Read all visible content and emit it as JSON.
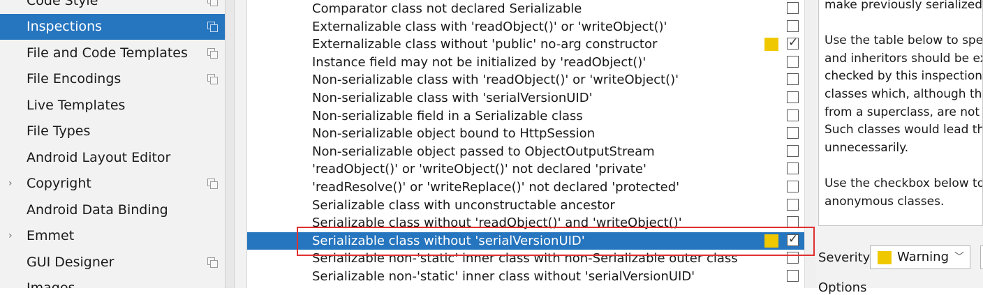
{
  "sidebar": {
    "items": [
      {
        "label": "Code Style",
        "arrow": "",
        "copy_icon": true
      },
      {
        "label": "Inspections",
        "arrow": "",
        "copy_icon": true,
        "selected": true
      },
      {
        "label": "File and Code Templates",
        "arrow": "",
        "copy_icon": true
      },
      {
        "label": "File Encodings",
        "arrow": "",
        "copy_icon": true
      },
      {
        "label": "Live Templates",
        "arrow": "",
        "copy_icon": false
      },
      {
        "label": "File Types",
        "arrow": "",
        "copy_icon": false
      },
      {
        "label": "Android Layout Editor",
        "arrow": "",
        "copy_icon": false
      },
      {
        "label": "Copyright",
        "arrow": "›",
        "copy_icon": true
      },
      {
        "label": "Android Data Binding",
        "arrow": "",
        "copy_icon": false
      },
      {
        "label": "Emmet",
        "arrow": "›",
        "copy_icon": false
      },
      {
        "label": "GUI Designer",
        "arrow": "",
        "copy_icon": true
      },
      {
        "label": "Images",
        "arrow": "",
        "copy_icon": false
      }
    ]
  },
  "inspections": {
    "rows": [
      {
        "label": "Comparator class not declared Serializable",
        "checked": false,
        "severity_color": ""
      },
      {
        "label": "Externalizable class with 'readObject()' or 'writeObject()'",
        "checked": false,
        "severity_color": ""
      },
      {
        "label": "Externalizable class without 'public' no-arg constructor",
        "checked": true,
        "severity_color": "#f0c800"
      },
      {
        "label": "Instance field may not be initialized by 'readObject()'",
        "checked": false,
        "severity_color": ""
      },
      {
        "label": "Non-serializable class with 'readObject()' or 'writeObject()'",
        "checked": false,
        "severity_color": ""
      },
      {
        "label": "Non-serializable class with 'serialVersionUID'",
        "checked": false,
        "severity_color": ""
      },
      {
        "label": "Non-serializable field in a Serializable class",
        "checked": false,
        "severity_color": ""
      },
      {
        "label": "Non-serializable object bound to HttpSession",
        "checked": false,
        "severity_color": ""
      },
      {
        "label": "Non-serializable object passed to ObjectOutputStream",
        "checked": false,
        "severity_color": ""
      },
      {
        "label": "'readObject()' or 'writeObject()' not declared 'private'",
        "checked": false,
        "severity_color": ""
      },
      {
        "label": "'readResolve()' or 'writeReplace()' not declared 'protected'",
        "checked": false,
        "severity_color": ""
      },
      {
        "label": "Serializable class with unconstructable ancestor",
        "checked": false,
        "severity_color": ""
      },
      {
        "label": "Serializable class without 'readObject()' and 'writeObject()'",
        "checked": false,
        "severity_color": ""
      },
      {
        "label": "Serializable class without 'serialVersionUID'",
        "checked": true,
        "severity_color": "#f0c800",
        "selected": true
      },
      {
        "label": "Serializable non-'static' inner class with non-Serializable outer class",
        "checked": false,
        "severity_color": ""
      },
      {
        "label": "Serializable non-'static' inner class without 'serialVersionUID'",
        "checked": false,
        "severity_color": ""
      },
      {
        "label": "",
        "checked": false,
        "severity_color": ""
      }
    ]
  },
  "description": {
    "lines": [
      "make previously serialized",
      "",
      "Use the table below to spe",
      "and inheritors should be ex",
      "checked by this inspection",
      "classes which, although the",
      "from a superclass, are not i",
      "Such classes would lead th",
      "unnecessarily.",
      "",
      "Use the checkbox below to",
      "anonymous classes."
    ]
  },
  "severity": {
    "label": "Severity:",
    "value": "Warning",
    "color": "#f0c800"
  },
  "options_label": "Options",
  "colors": {
    "selection": "#2675bf",
    "highlight_box": "#e03030",
    "warning": "#f0c800"
  }
}
